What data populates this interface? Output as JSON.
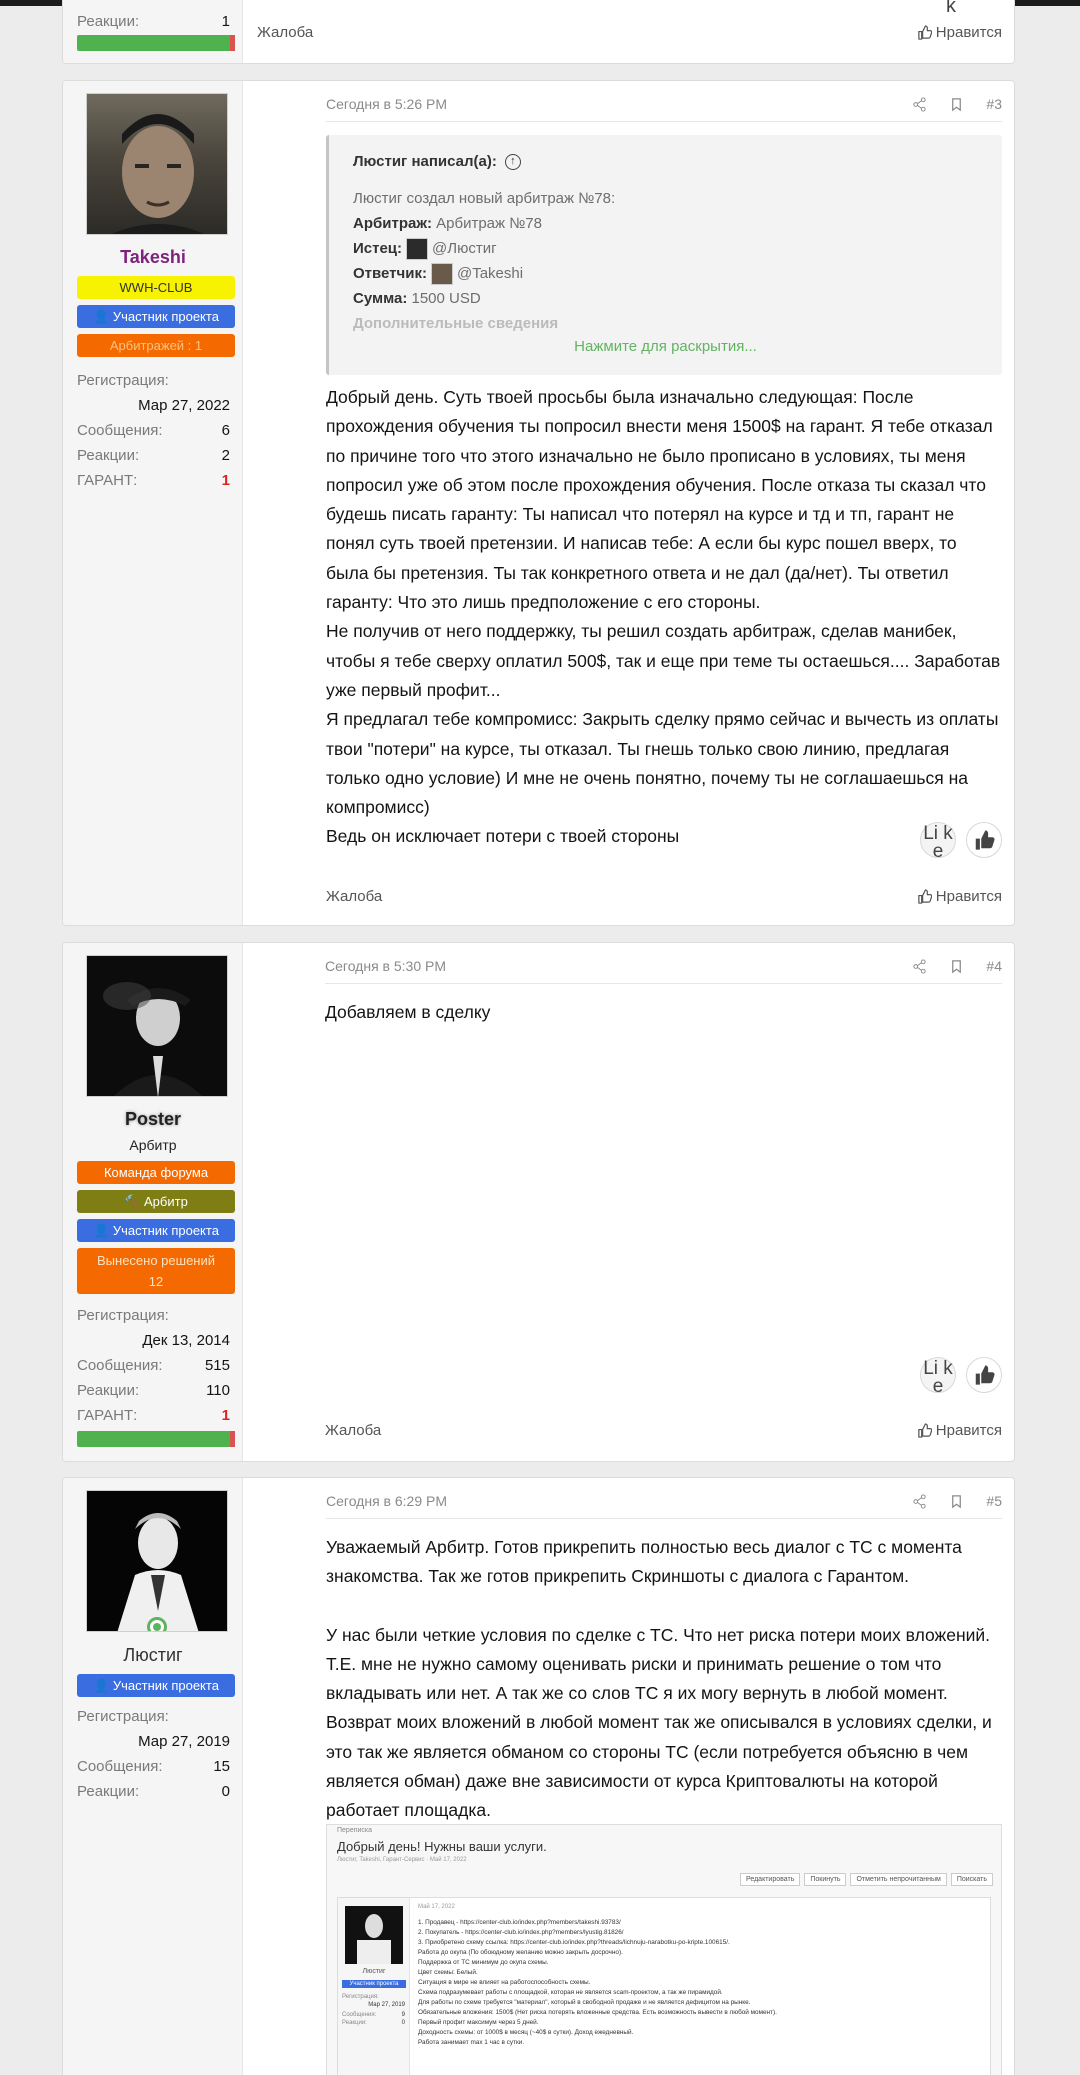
{
  "post0": {
    "reactions_label": "Реакции:",
    "reactions_value": "1",
    "report": "Жалоба",
    "like": "Нравится",
    "stray_char": "k"
  },
  "post3": {
    "username": "Takeshi",
    "banner1": "WWH-CLUB",
    "banner2": "Участник проекта",
    "banner3": "Арбитражей : 1",
    "reg_label": "Регистрация:",
    "reg_value": "Мар 27, 2022",
    "msg_label": "Сообщения:",
    "msg_value": "6",
    "react_label": "Реакции:",
    "react_value": "2",
    "garant_label": "ГАРАНТ:",
    "garant_value": "1",
    "date": "Сегодня в 5:26 PM",
    "number": "#3",
    "quote_header": "Люстиг написал(а):",
    "quote_line1": "Люстиг создал новый арбитраж №78:",
    "quote_arb_label": "Арбитраж:",
    "quote_arb_value": "Арбитраж №78",
    "quote_ist_label": "Истец:",
    "quote_ist_value": "@Люстиг",
    "quote_otv_label": "Ответчик:",
    "quote_otv_value": "@Takeshi",
    "quote_sum_label": "Сумма:",
    "quote_sum_value": "1500 USD",
    "quote_more": "Дополнительные сведения",
    "quote_expand": "Нажмите для раскрытия...",
    "p1": "Добрый день. Суть твоей просьбы была изначально следующая: После прохождения обучения ты попросил внести меня 1500$ на гарант. Я тебе отказал по причине того что этого изначально не было прописано в условиях, ты меня попросил уже об этом после прохождения обучения. После отказа ты сказал что будешь писать гаранту: Ты написал что потерял на курсе и тд и тп, гарант не понял суть твоей претензии. И написав тебе: А если бы курс пошел вверх, то была бы претензия. Ты так конкретного ответа и не дал (да/нет). Ты ответил гаранту: Что это лишь предположение с его стороны.",
    "p2": "Не получив от него поддержку, ты решил создать арбитраж, сделав манибек, чтобы я тебе сверху оплатил 500$, так и еще при теме ты остаешься.... Заработав уже первый профит...",
    "p3": "Я предлагал тебе компромисс: Закрыть сделку прямо сейчас и вычесть из оплаты твои \"потери\" на курсе, ты отказал. Ты гнешь только свою линию, предлагая только одно условие) И мне не очень понятно, почему ты не соглашаешься на компромисс)",
    "p4": "Ведь он исключает потери с твоей стороны",
    "react_text": "Li k e",
    "report": "Жалоба",
    "like": "Нравится"
  },
  "post4": {
    "username": "Poster",
    "title": "Арбитр",
    "banner1": "Команда форума",
    "banner2": "Арбитр",
    "banner3": "Участник проекта",
    "banner4": "Вынесено решений",
    "banner4_count": "12",
    "reg_label": "Регистрация:",
    "reg_value": "Дек 13, 2014",
    "msg_label": "Сообщения:",
    "msg_value": "515",
    "react_label": "Реакции:",
    "react_value": "110",
    "garant_label": "ГАРАНТ:",
    "garant_value": "1",
    "date": "Сегодня в 5:30 PM",
    "number": "#4",
    "text": "Добавляем в сделку",
    "react_text": "Li k e",
    "report": "Жалоба",
    "like": "Нравится"
  },
  "post5": {
    "username": "Люстиг",
    "banner1": "Участник проекта",
    "reg_label": "Регистрация:",
    "reg_value": "Мар 27, 2019",
    "msg_label": "Сообщения:",
    "msg_value": "15",
    "react_label": "Реакции:",
    "react_value": "0",
    "date": "Сегодня в 6:29 PM",
    "number": "#5",
    "p1": "Уважаемый Арбитр. Готов прикрепить полностью весь диалог с ТС с момента знакомства. Так же готов прикрепить Скриншоты с диалога с Гарантом.",
    "p2": "У нас были четкие условия по сделке с ТС. Что нет риска потери моих вложений. Т.Е. мне не нужно самому оценивать риски и принимать решение о том что вкладывать или нет. А так же со слов ТС я их могу вернуть в любой момент. Возврат моих вложений в любой момент так же описывался в условиях сделки, и это так же является обманом со стороны ТС (если потребуется объясню в чем является обман) даже вне зависимости от курса Криптовалюты на которой работает площадка.",
    "shot_crumb": "Переписка",
    "shot_title": "Добрый день! Нужны ваши услуги.",
    "shot_meta": "Люстиг, Takeshi, Гарант-Сервис · Май 17, 2022",
    "shot_btn1": "Редактировать",
    "shot_btn2": "Покинуть",
    "shot_btn3": "Отметить непрочитанным",
    "shot_btn4": "Поискать",
    "shot_date": "Май 17, 2022",
    "shot_user": "Люстиг",
    "shot_badge": "Участник проекта",
    "shot_reg_label": "Регистрация:",
    "shot_reg_value": "Мар 27, 2019",
    "shot_msg_label": "Сообщения:",
    "shot_msg_value": "9",
    "shot_react_label": "Реакции:",
    "shot_react_value": "0",
    "shot_lines": [
      "1. Продавец - https://center-club.io/index.php?members/takeshi.93783/",
      "2. Покупатель - https://center-club.io/index.php?members/lyustig.81826/",
      "3. Приобретено схему ссылка: https://center-club.io/index.php?threads/lichnuju-narabotku-po-kripte.100615/.",
      "Работа до окупа (По обоюдному желанию можно закрыть досрочно).",
      "Поддержка от ТС минимум до окупа схемы.",
      "Цвет схемы: Белый.",
      "Ситуация в мире не влияет на работоспособность схемы.",
      "Схема подразумевает работы с площадкой, которая не является scam-проектом, а так же пирамидой.",
      "Для работы по схеме требуется \"материал\", который в свободной продаже и не является дефицитом на рынке.",
      "Обязательные вложения: 1500$ (Нет риска потерять вложенные средства. Есть возможность вывести в любой момент).",
      "Первый профит максимум через 5 дней.",
      "Доходность схемы: от 1000$ в месяц (~40$ в сутки). Доход ежедневный.",
      "Работа занимает max 1 час в сутки."
    ]
  }
}
